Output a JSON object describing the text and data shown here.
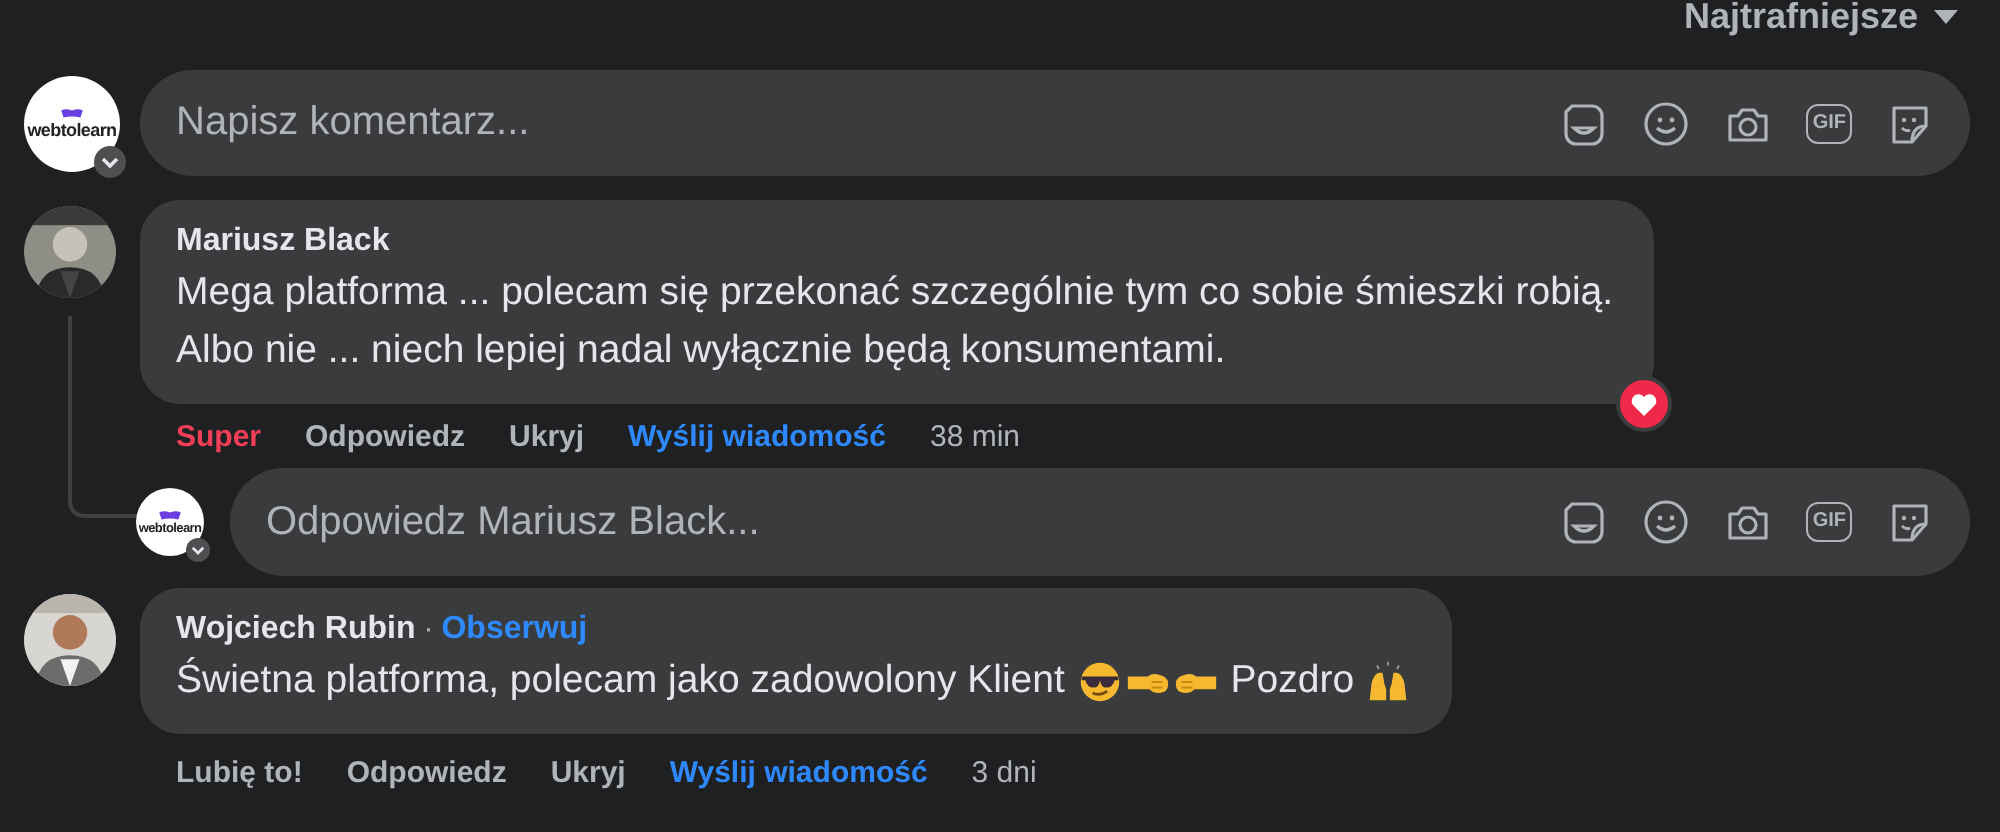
{
  "sort": {
    "label": "Najtrafniejsze"
  },
  "composer": {
    "avatar": {
      "logo_text": "webtolearn"
    },
    "placeholder": "Napisz komentarz...",
    "tools": [
      {
        "kind": "avatar"
      },
      {
        "kind": "emoji"
      },
      {
        "kind": "camera"
      },
      {
        "kind": "gif",
        "label": "GIF"
      },
      {
        "kind": "sticker"
      }
    ]
  },
  "comments": [
    {
      "author": "Mariusz Black",
      "body": [
        {
          "kind": "text",
          "text": "Mega platforma ... polecam się przekonać szczególnie tym co sobie śmieszki robią.\nAlbo nie ... niech lepiej nadal wyłącznie będą konsumentami."
        }
      ],
      "reactions": [
        {
          "kind": "love"
        }
      ],
      "actions": [
        {
          "kind": "reaction",
          "label": "Super",
          "selected": true
        },
        {
          "kind": "reply",
          "label": "Odpowiedz"
        },
        {
          "kind": "hide",
          "label": "Ukryj"
        },
        {
          "kind": "message",
          "label": "Wyślij wiadomość"
        },
        {
          "kind": "time",
          "label": "38 min"
        }
      ],
      "reply_box": {
        "avatar": {
          "logo_text": "webtolearn"
        },
        "placeholder": "Odpowiedz Mariusz Black...",
        "tools": [
          {
            "kind": "avatar"
          },
          {
            "kind": "emoji"
          },
          {
            "kind": "camera"
          },
          {
            "kind": "gif",
            "label": "GIF"
          },
          {
            "kind": "sticker"
          }
        ]
      }
    },
    {
      "author": "Wojciech Rubin",
      "separator": "·",
      "follow_link": "Obserwuj",
      "body": [
        {
          "kind": "text",
          "text": "Świetna platforma, polecam jako zadowolony Klient "
        },
        {
          "kind": "cool-face"
        },
        {
          "kind": "fist-right"
        },
        {
          "kind": "fist-left"
        },
        {
          "kind": "text",
          "text": " Pozdro "
        },
        {
          "kind": "raised-hands"
        }
      ],
      "actions": [
        {
          "kind": "reaction",
          "label": "Lubię to!",
          "selected": false
        },
        {
          "kind": "reply",
          "label": "Odpowiedz"
        },
        {
          "kind": "hide",
          "label": "Ukryj"
        },
        {
          "kind": "message",
          "label": "Wyślij wiadomość"
        },
        {
          "kind": "time",
          "label": "3 dni"
        }
      ]
    }
  ]
}
